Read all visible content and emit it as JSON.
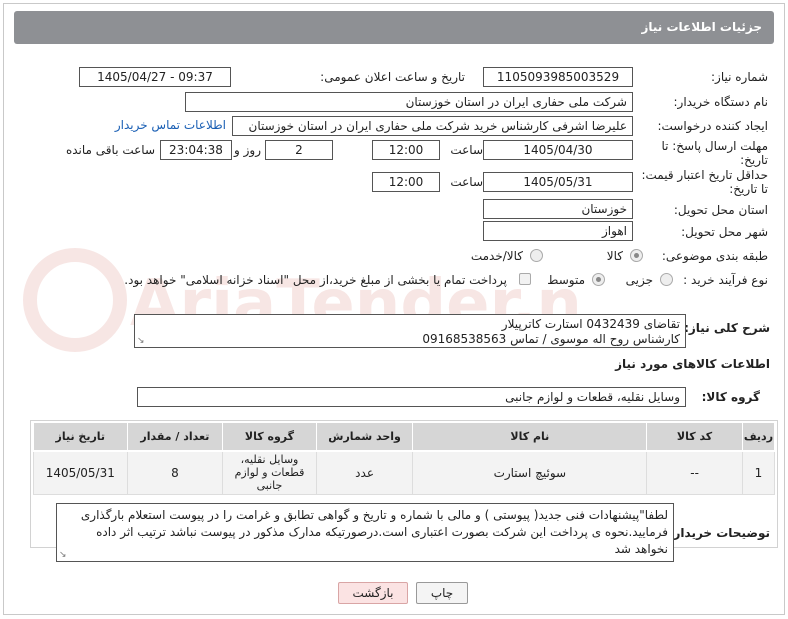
{
  "header": {
    "title": "جزئیات اطلاعات نیاز"
  },
  "fields": {
    "need_number": {
      "label": "شماره نیاز:",
      "value": "1105093985003529"
    },
    "announce_datetime": {
      "label": "تاریخ و ساعت اعلان عمومی:",
      "value": "1405/04/27 - 09:37"
    },
    "buyer_org": {
      "label": "نام دستگاه خریدار:",
      "value": "شرکت ملی حفاری ایران در استان خوزستان"
    },
    "requester": {
      "label": "ایجاد کننده درخواست:",
      "value": "علیرضا اشرفی کارشناس خرید شرکت ملی حفاری ایران در استان خوزستان",
      "link": "اطلاعات تماس خریدار"
    },
    "reply_deadline": {
      "label": "مهلت ارسال پاسخ: تا تاریخ:",
      "date": "1405/04/30",
      "time_label": "ساعت",
      "time": "12:00",
      "days": "2",
      "days_label": "روز و",
      "remaining": "23:04:38",
      "remaining_label": "ساعت باقی مانده"
    },
    "price_validity": {
      "label": "حداقل تاریخ اعتبار قیمت: تا تاریخ:",
      "date": "1405/05/31",
      "time_label": "ساعت",
      "time": "12:00"
    },
    "delivery_province": {
      "label": "استان محل تحویل:",
      "value": "خوزستان"
    },
    "delivery_city": {
      "label": "شهر محل تحویل:",
      "value": "اهواز"
    },
    "category": {
      "label": "طبقه بندی موضوعی:",
      "options": [
        "کالا",
        "کالا/خدمت"
      ],
      "selected": "کالا"
    },
    "process_type": {
      "label": "نوع فرآیند خرید :",
      "options": [
        "جزیی",
        "متوسط"
      ],
      "selected": "متوسط",
      "payment_note": "پرداخت تمام یا بخشی از مبلغ خرید،از محل \"اسناد خزانه اسلامی\" خواهد بود."
    }
  },
  "description": {
    "label": "شرح کلی نیاز:",
    "lines": [
      "تقاضای 0432439 استارت کاترپیلار",
      "کارشناس روح اله موسوی / تماس 09168538563"
    ]
  },
  "goods_section": {
    "title": "اطلاعات کالاهای مورد نیاز",
    "group_label": "گروه کالا:",
    "group_value": "وسایل نقلیه، قطعات و لوازم جانبی"
  },
  "table": {
    "headers": [
      "ردیف",
      "کد کالا",
      "نام کالا",
      "واحد شمارش",
      "گروه کالا",
      "تعداد / مقدار",
      "تاریخ نیاز"
    ],
    "rows": [
      {
        "row": "1",
        "code": "--",
        "name": "سوئیچ استارت",
        "unit": "عدد",
        "group": "وسایل نقلیه، قطعات و لوازم جانبی",
        "qty": "8",
        "date": "1405/05/31"
      }
    ]
  },
  "buyer_notes": {
    "label": "توضیحات خریدار:",
    "text": "لطفا\"پیشنهادات فنی جدید( پیوستی ) و مالی با شماره و تاریخ و گواهی تطابق و غرامت را در پیوست استعلام بارگذاری فرمایید.نحوه ی پرداخت این شرکت بصورت اعتباری است.درصورتیکه مدارک مذکور در پیوست نباشد ترتیب اثر داده نخواهد شد"
  },
  "buttons": {
    "print": "چاپ",
    "back": "بازگشت"
  },
  "watermark": {
    "text": "AriaTender.neT",
    "color": "#c0392b"
  }
}
